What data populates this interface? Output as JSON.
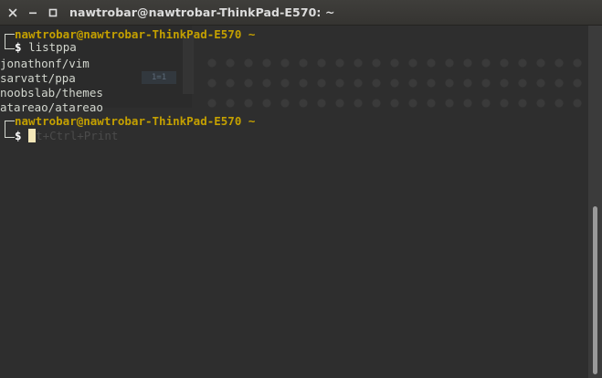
{
  "window": {
    "title": "nawtrobar@nawtrobar-ThinkPad-E570: ~",
    "controls": {
      "close": "close-icon",
      "minimize": "minimize-icon",
      "maximize": "maximize-icon"
    }
  },
  "terminal": {
    "prompt_user": "nawtrobar@nawtrobar-ThinkPad-E570",
    "prompt_path": " ~",
    "dollar": "$ ",
    "command": "listppa",
    "output": [
      "jonathonf/vim",
      "sarvatt/ppa",
      "noobslab/themes",
      "atareao/atareao"
    ],
    "ghost_chip": "1=1",
    "ghost_text": "t+Ctrl+Print"
  },
  "colors": {
    "prompt": "#c4a000",
    "text": "#d3d7cf",
    "cursor": "#f4e7b8",
    "background": "#2e2e2e"
  }
}
